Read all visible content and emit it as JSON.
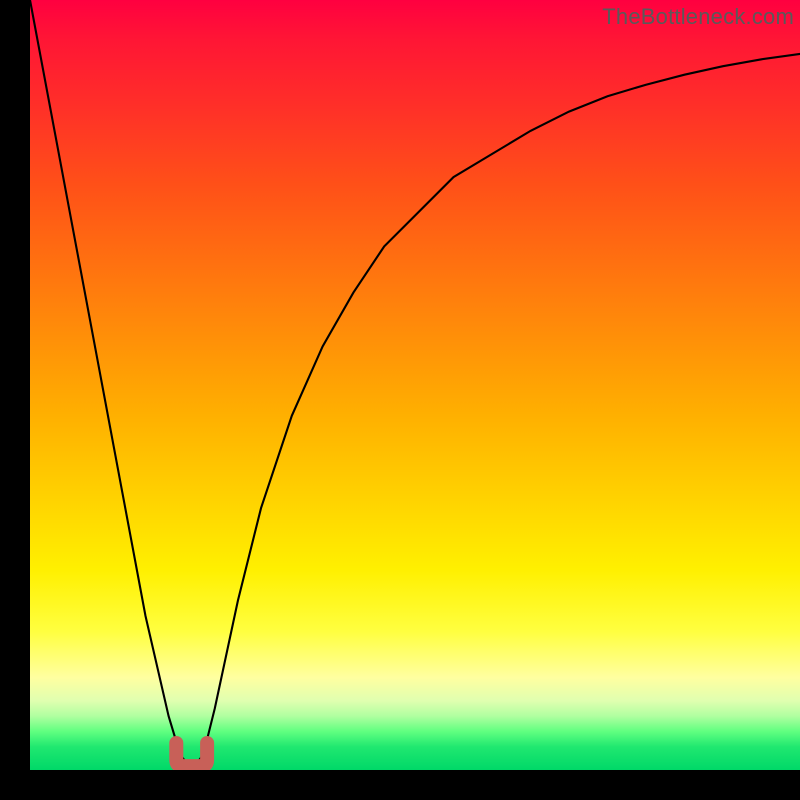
{
  "watermark": "TheBottleneck.com",
  "colors": {
    "frame": "#000000",
    "curve": "#000000",
    "marker": "#c86058",
    "gradient_top": "#ff0040",
    "gradient_bottom": "#00d868"
  },
  "chart_data": {
    "type": "line",
    "title": "",
    "xlabel": "",
    "ylabel": "",
    "xlim": [
      0,
      100
    ],
    "ylim": [
      0,
      100
    ],
    "x": [
      0,
      3,
      6,
      9,
      12,
      15,
      18,
      19.5,
      21,
      22.5,
      24,
      27,
      30,
      34,
      38,
      42,
      46,
      50,
      55,
      60,
      65,
      70,
      75,
      80,
      85,
      90,
      95,
      100
    ],
    "values": [
      100,
      84,
      68,
      52,
      36,
      20,
      7,
      2,
      0,
      2,
      8,
      22,
      34,
      46,
      55,
      62,
      68,
      72,
      77,
      80,
      83,
      85.5,
      87.5,
      89,
      90.3,
      91.4,
      92.3,
      93
    ],
    "marker": {
      "x_range": [
        19,
        23
      ],
      "y": 0,
      "shape": "u",
      "color": "#c86058"
    },
    "gradient_note": "Background vertical gradient maps bottleneck percentage to color: green at bottom (0%), red at top (100%)."
  }
}
